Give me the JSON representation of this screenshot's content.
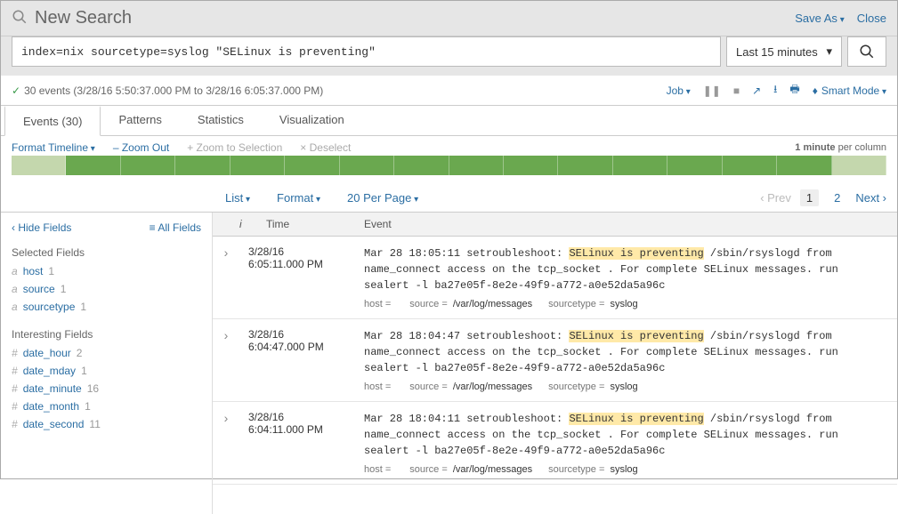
{
  "header": {
    "title": "New Search",
    "save_as": "Save As",
    "close": "Close"
  },
  "search": {
    "query": "index=nix sourcetype=syslog \"SELinux is preventing\"",
    "time_range": "Last 15 minutes"
  },
  "status": {
    "text": "30 events (3/28/16 5:50:37.000 PM to 3/28/16 6:05:37.000 PM)",
    "job": "Job",
    "mode": "Smart Mode"
  },
  "tabs": {
    "events": "Events (30)",
    "patterns": "Patterns",
    "statistics": "Statistics",
    "visualization": "Visualization"
  },
  "timeline": {
    "format": "Format Timeline",
    "zoom_out": "– Zoom Out",
    "zoom_sel": "+ Zoom to Selection",
    "deselect": "× Deselect",
    "percol_prefix": "1 minute",
    "percol_suffix": " per column"
  },
  "listctrl": {
    "list": "List",
    "format": "Format",
    "perpage": "20 Per Page",
    "prev": "‹ Prev",
    "p1": "1",
    "p2": "2",
    "next": "Next ›"
  },
  "sidebar": {
    "hide": "Hide Fields",
    "all": "All Fields",
    "selected_title": "Selected Fields",
    "interesting_title": "Interesting Fields",
    "selected": [
      {
        "type": "a",
        "name": "host",
        "count": "1"
      },
      {
        "type": "a",
        "name": "source",
        "count": "1"
      },
      {
        "type": "a",
        "name": "sourcetype",
        "count": "1"
      }
    ],
    "interesting": [
      {
        "type": "#",
        "name": "date_hour",
        "count": "2"
      },
      {
        "type": "#",
        "name": "date_mday",
        "count": "1"
      },
      {
        "type": "#",
        "name": "date_minute",
        "count": "16"
      },
      {
        "type": "#",
        "name": "date_month",
        "count": "1"
      },
      {
        "type": "#",
        "name": "date_second",
        "count": "11"
      }
    ]
  },
  "ev_header": {
    "i": "i",
    "time": "Time",
    "event": "Event"
  },
  "events": [
    {
      "date": "3/28/16",
      "time": "6:05:11.000 PM",
      "pre": "Mar 28 18:05:11          setroubleshoot: ",
      "hl": "SELinux is preventing",
      "post": " /sbin/rsyslogd from name_connect access on the tcp_socket . For complete SELinux messages. run sealert -l ba27e05f-8e2e-49f9-a772-a0e52da5a96c",
      "host": " ",
      "source": "/var/log/messages",
      "sourcetype": "syslog"
    },
    {
      "date": "3/28/16",
      "time": "6:04:47.000 PM",
      "pre": "Mar 28 18:04:47          setroubleshoot: ",
      "hl": "SELinux is preventing",
      "post": " /sbin/rsyslogd from name_connect access on the tcp_socket . For complete SELinux messages. run sealert -l ba27e05f-8e2e-49f9-a772-a0e52da5a96c",
      "host": " ",
      "source": "/var/log/messages",
      "sourcetype": "syslog"
    },
    {
      "date": "3/28/16",
      "time": "6:04:11.000 PM",
      "pre": "Mar 28 18:04:11          setroubleshoot: ",
      "hl": "SELinux is preventing",
      "post": " /sbin/rsyslogd from name_connect access on the tcp_socket . For complete SELinux messages. run sealert -l ba27e05f-8e2e-49f9-a772-a0e52da5a96c",
      "host": " ",
      "source": "/var/log/messages",
      "sourcetype": "syslog"
    }
  ],
  "meta_labels": {
    "host": "host =",
    "source": "source =",
    "sourcetype": "sourcetype ="
  }
}
